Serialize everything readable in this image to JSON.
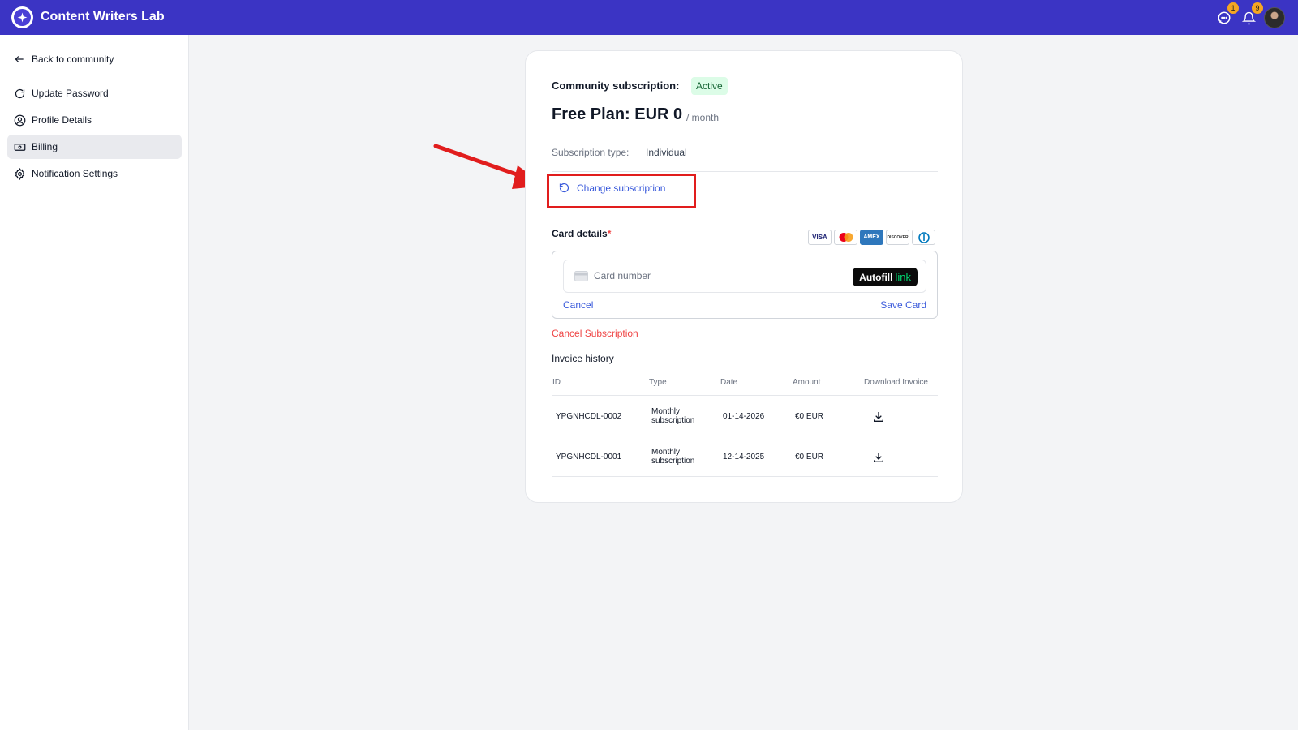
{
  "app": {
    "title": "Content Writers Lab"
  },
  "header": {
    "messages_badge": "1",
    "notifications_badge": "9"
  },
  "sidebar": {
    "items": [
      {
        "label": "Back to community",
        "icon": "arrow-left-icon"
      },
      {
        "label": "Update Password",
        "icon": "refresh-icon"
      },
      {
        "label": "Profile Details",
        "icon": "user-circle-icon"
      },
      {
        "label": "Billing",
        "icon": "billing-icon",
        "active": true
      },
      {
        "label": "Notification Settings",
        "icon": "gear-icon"
      }
    ]
  },
  "subscription": {
    "label": "Community subscription:",
    "status": "Active",
    "plan_name": "Free Plan: EUR 0",
    "plan_period": "/ month",
    "type_label": "Subscription type:",
    "type_value": "Individual",
    "change_label": "Change subscription"
  },
  "card_details": {
    "label": "Card details",
    "required_mark": "*",
    "brands": [
      "VISA",
      "mastercard",
      "AMEX",
      "DISCOVER",
      "diners"
    ],
    "placeholder": "Card number",
    "autofill_label": "Autofill",
    "autofill_link": "link",
    "cancel_label": "Cancel",
    "save_label": "Save Card"
  },
  "cancel_subscription_label": "Cancel Subscription",
  "invoices": {
    "title": "Invoice history",
    "columns": [
      "ID",
      "Type",
      "Date",
      "Amount",
      "Download Invoice"
    ],
    "rows": [
      {
        "id": "YPGNHCDL-0002",
        "type_line1": "Monthly",
        "type_line2": "subscription",
        "date": "01-14-2026",
        "amount": "€0 EUR"
      },
      {
        "id": "YPGNHCDL-0001",
        "type_line1": "Monthly",
        "type_line2": "subscription",
        "date": "12-14-2025",
        "amount": "€0 EUR"
      }
    ]
  },
  "colors": {
    "topbar": "#3b34c4",
    "link": "#3b5bdb",
    "danger": "#ef4444",
    "annotation": "#e11d1d",
    "active_badge_bg": "#dcfce7"
  }
}
